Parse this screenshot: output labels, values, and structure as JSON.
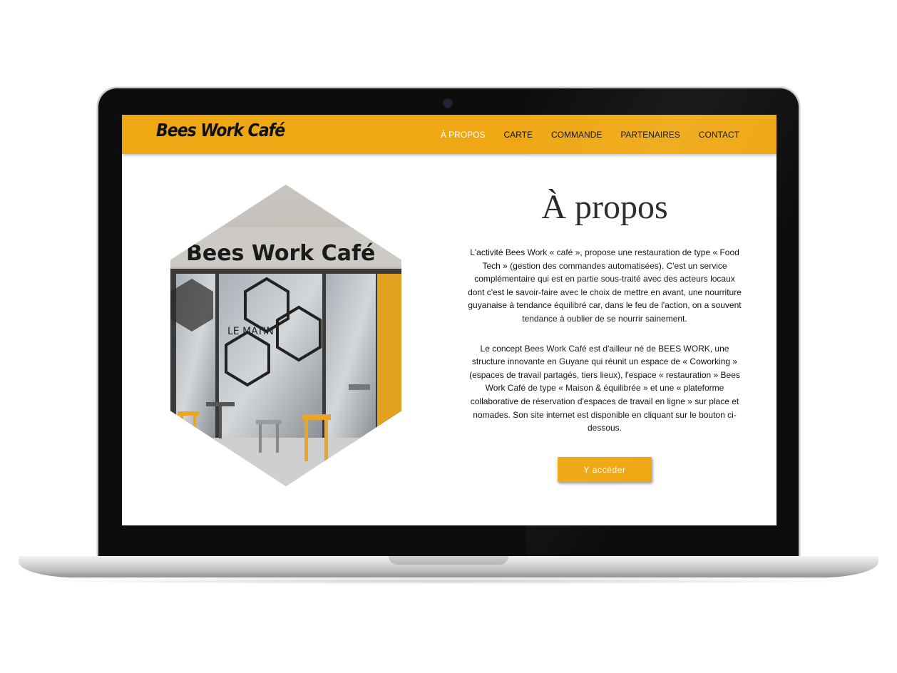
{
  "site": {
    "logo_text": "Bees Work Café",
    "brand_color": "#efa813"
  },
  "nav": {
    "items": [
      {
        "label": "À PROPOS",
        "active": true
      },
      {
        "label": "CARTE"
      },
      {
        "label": "COMMANDE"
      },
      {
        "label": "PARTENAIRES"
      },
      {
        "label": "CONTACT"
      }
    ]
  },
  "hero": {
    "photo_sign_text": "Bees Work Café",
    "photo_window_text": "LE MATIN"
  },
  "main": {
    "title": "À propos",
    "paragraphs": [
      "L'activité Bees Work « café », propose une restauration de type « Food Tech » (gestion des commandes automatisées). C'est un service complémentaire qui est en partie sous-traité avec des acteurs locaux dont c'est le savoir-faire avec le choix de mettre en avant, une nourriture guyanaise à tendance équilibré car, dans le feu de l'action, on a souvent tendance à oublier de se nourrir sainement.",
      "Le concept Bees Work Café est d'ailleur né de BEES WORK, une structure innovante en Guyane qui réunit un espace de « Coworking » (espaces de travail partagés, tiers lieux), l'espace « restauration » Bees Work Café de type « Maison & équilibrée » et une « plateforme collaborative de réservation d'espaces de travail en ligne » sur place et nomades. Son site internet est disponible en cliquant sur le bouton ci-dessous."
    ],
    "button_label": "Y accéder"
  }
}
